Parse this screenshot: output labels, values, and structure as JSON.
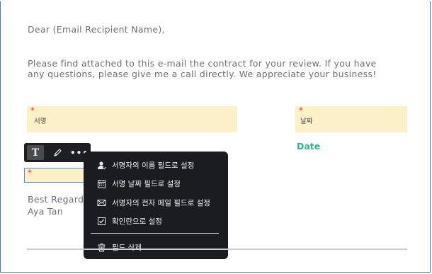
{
  "email": {
    "greeting": "Dear (Email Recipient Name),",
    "body_line1": "Please find attached to this e-mail the contract for your review. If you have",
    "body_line2": "any questions, please give me a call directly. We appreciate your business!",
    "closing": "Best Regards",
    "signer_name": "Aya Tan"
  },
  "fields": {
    "signature_label": "서명",
    "date_label": "날짜",
    "date_title": "Date",
    "required_marker": "*"
  },
  "toolbar": {
    "text_tool": "T",
    "more_tool": "•••"
  },
  "context_menu": {
    "items": [
      {
        "label": "서명자의 이름 필드로 설정",
        "icon": "person-icon"
      },
      {
        "label": "서명 날짜 필드로 설정",
        "icon": "calendar-icon"
      },
      {
        "label": "서명자의 전자 메일 필드로 설정",
        "icon": "envelope-icon"
      },
      {
        "label": "확인란으로 설정",
        "icon": "checkbox-icon"
      },
      {
        "label": "필드 삭제",
        "icon": "trash-icon"
      }
    ]
  },
  "colors": {
    "field_bg": "#fbf0c8",
    "required": "#e43a2b",
    "date_accent": "#2fb38e",
    "menu_bg": "#1b1c1f",
    "selection_border": "#4a90d9"
  }
}
